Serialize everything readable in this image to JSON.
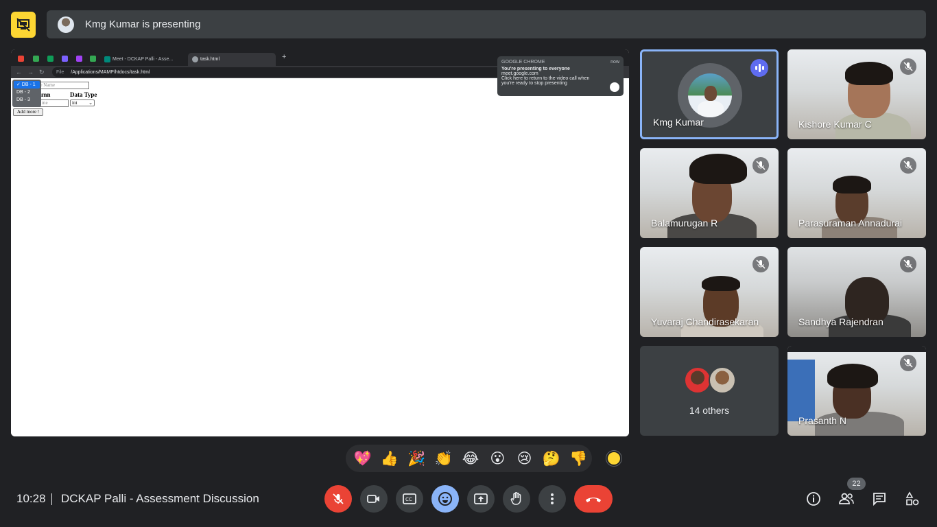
{
  "banner": {
    "text": "Kmg Kumar is presenting"
  },
  "shared_screen": {
    "tabs": [
      "Meet - DCKAP Palli - Asse...",
      "task.html"
    ],
    "url": "/Applications/MAMP/htdocs/task.html",
    "url_prefix": "File",
    "page": {
      "table_name_placeholder": "ble Name",
      "column_header": "umn",
      "datatype_header": "Data Type",
      "column_input_placeholder": "me",
      "datatype_value": "int",
      "add_button": "Add more !",
      "dropdown_options": [
        "✓ DB - 1",
        "DB - 2",
        "DB - 3"
      ]
    },
    "notification": {
      "source": "GOOGLE CHROME",
      "time": "now",
      "title": "You're presenting to everyone",
      "site": "meet.google.com",
      "body": "Click here to return to the video call when you're ready to stop presenting"
    }
  },
  "participants": [
    {
      "name": "Kmg Kumar",
      "speaking": true
    },
    {
      "name": "Kishore Kumar C",
      "muted": true
    },
    {
      "name": "Balamurugan R",
      "muted": true
    },
    {
      "name": "Parasuraman Annadurai",
      "muted": true
    },
    {
      "name": "Yuvaraj Chandirasekaran",
      "muted": true
    },
    {
      "name": "Sandhya Rajendran",
      "muted": true
    },
    {
      "name": "Prasanth N",
      "muted": true
    }
  ],
  "others": {
    "label": "14 others"
  },
  "reactions": [
    "💖",
    "👍",
    "🎉",
    "👏",
    "😂",
    "😮",
    "😢",
    "🤔",
    "👎"
  ],
  "meeting": {
    "time": "10:28",
    "name": "DCKAP Palli - Assessment Discussion"
  },
  "people_count": "22",
  "colors": {
    "accent": "#8ab4f8",
    "danger": "#ea4335",
    "present_icon": "#fdd633",
    "speaking": "#5f6cf0"
  }
}
